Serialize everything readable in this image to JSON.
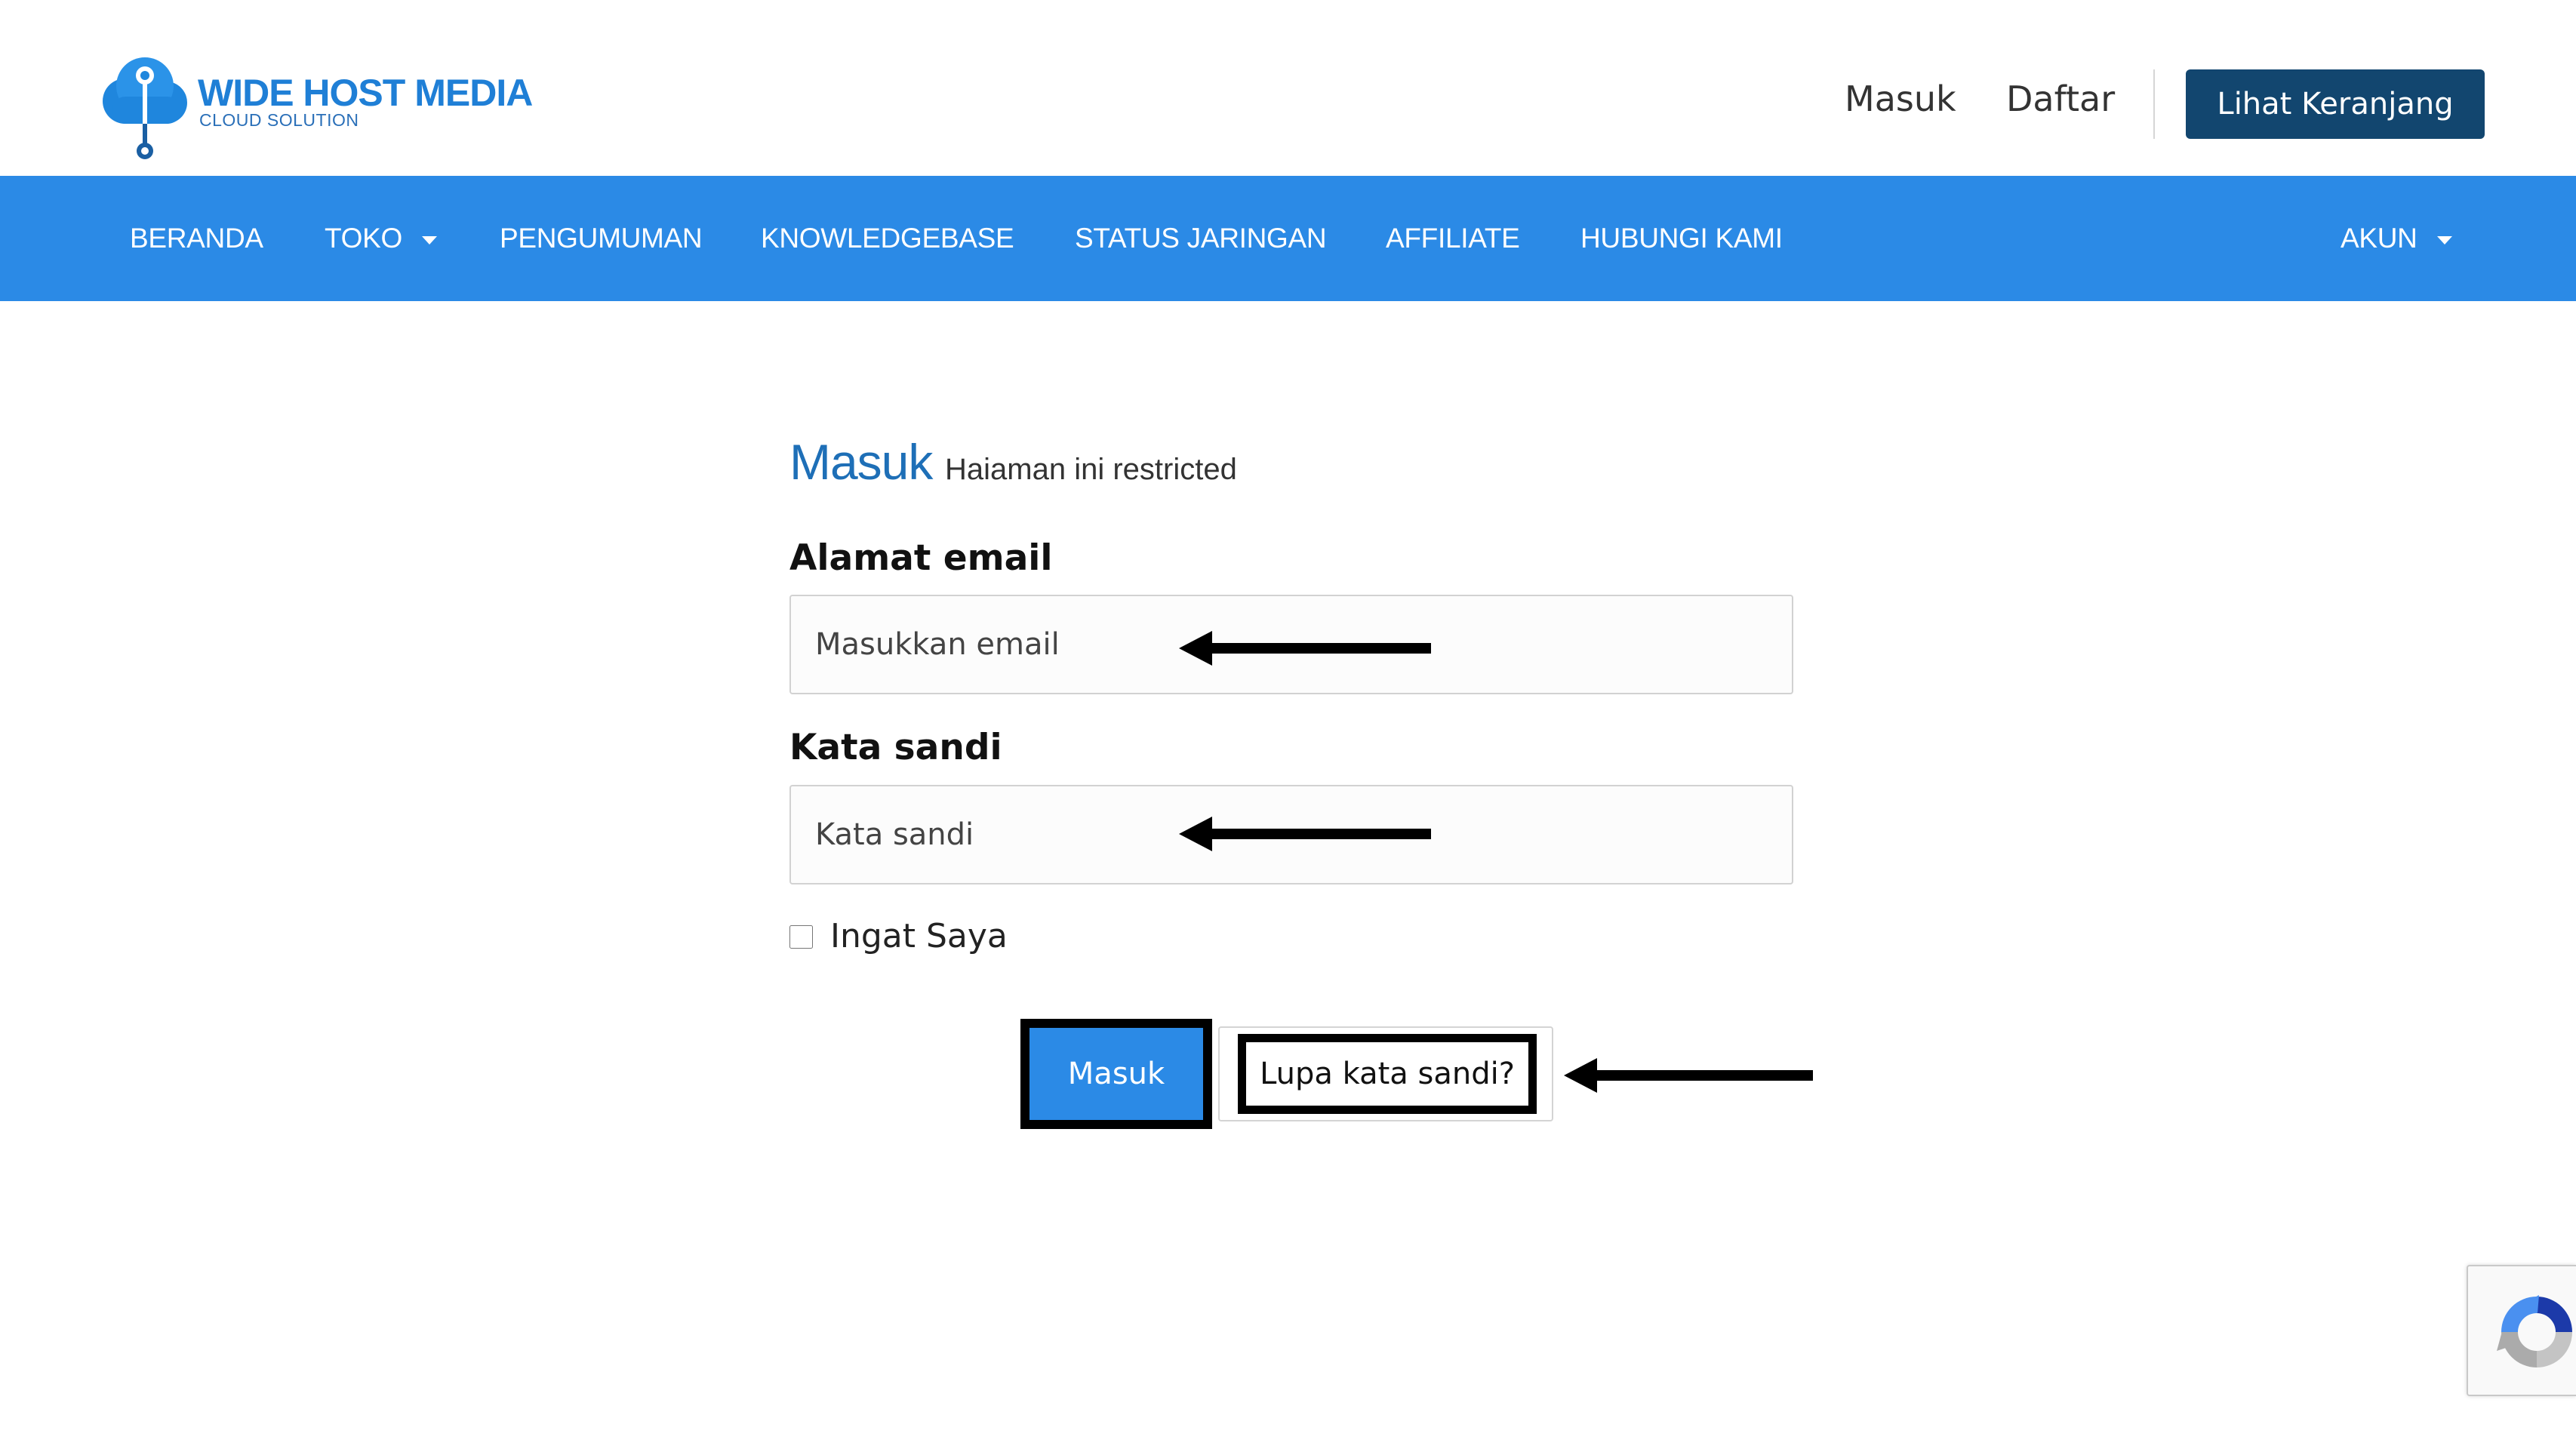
{
  "brand": {
    "name": "WIDE HOST MEDIA",
    "tagline": "CLOUD SOLUTION",
    "color": "#1f7fd6"
  },
  "header": {
    "login_label": "Masuk",
    "register_label": "Daftar",
    "cart_label": "Lihat Keranjang",
    "cart_color": "#12466f"
  },
  "nav": {
    "background": "#2b8ae6",
    "items": [
      {
        "label": "BERANDA"
      },
      {
        "label": "TOKO"
      },
      {
        "label": "PENGUMUMAN"
      },
      {
        "label": "KNOWLEDGEBASE"
      },
      {
        "label": "STATUS JARINGAN"
      },
      {
        "label": "AFFILIATE"
      },
      {
        "label": "HUBUNGI KAMI"
      },
      {
        "label": "AKUN"
      }
    ]
  },
  "login": {
    "title": "Masuk",
    "subtitle": "Haiaman ini restricted",
    "email_label": "Alamat email",
    "email_placeholder": "Masukkan email",
    "email_value": "",
    "password_label": "Kata sandi",
    "password_placeholder": "Kata sandi",
    "password_value": "",
    "remember_label": "Ingat Saya",
    "remember_checked": false,
    "submit_label": "Masuk",
    "forgot_label": "Lupa kata sandi?"
  },
  "annotations": {
    "arrow_color": "#000000"
  }
}
